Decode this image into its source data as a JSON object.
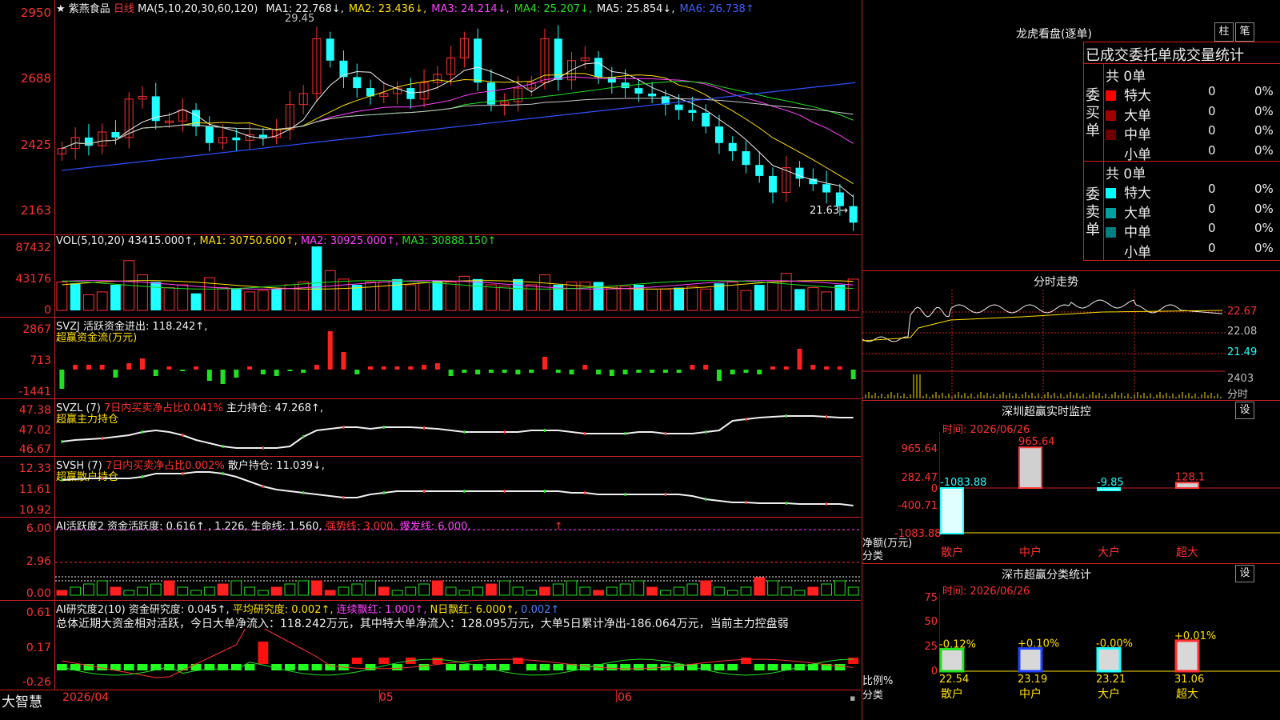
{
  "stock": {
    "name": "紫燕食品",
    "period": "日线"
  },
  "main": {
    "ma_label": "MA(5,10,20,30,60,120)",
    "ma": [
      {
        "label": "MA1: 22.768↓,",
        "color": "#f0f0f0"
      },
      {
        "label": "MA2: 23.436↓,",
        "color": "#ffe000"
      },
      {
        "label": "MA3: 24.214↓,",
        "color": "#ff40ff"
      },
      {
        "label": "MA4: 25.207↓,",
        "color": "#20e020"
      },
      {
        "label": "MA5: 25.854↓,",
        "color": "#f0f0f0"
      },
      {
        "label": "MA6: 26.738↑",
        "color": "#4060ff"
      }
    ],
    "y_ticks": [
      "2950",
      "2688",
      "2425",
      "2163"
    ],
    "high_label": "29.45",
    "low_label": "21.63→"
  },
  "vol": {
    "label": "VOL(5,10,20)",
    "value": "43415.000↑,",
    "ma1": "MA1: 30750.600↑,",
    "ma2": "MA2: 30925.000↑,",
    "ma3": "MA3: 30888.150↑",
    "y_ticks": [
      "87432",
      "43176",
      "0"
    ]
  },
  "svzj": {
    "label": "SVZJ",
    "text": "活跃资金进出: 118.242↑,",
    "sub": "超赢资金流(万元)",
    "y_ticks": [
      "2867",
      "713",
      "-1441"
    ]
  },
  "svzl": {
    "label": "SVZL (7)",
    "ratio": "7日内买卖净占比0.041%",
    "hold": "主力持仓: 47.268↑,",
    "sub": "超赢主力持仓",
    "y_ticks": [
      "47.38",
      "47.02",
      "46.67"
    ]
  },
  "svsh": {
    "label": "SVSH (7)",
    "ratio": "7日内买卖净占比0.002%",
    "hold": "散户持仓: 11.039↓,",
    "sub": "超赢散户持仓",
    "y_ticks": [
      "12.33",
      "11.61",
      "10.92"
    ]
  },
  "ai1": {
    "label": "AI活跃度2",
    "t1": "资金活跃度: 0.616↑",
    "t2": ", 1.226,",
    "t3": "生命线: 1.560,",
    "t4": "强势线: 3.000,",
    "t5": "爆发线: 6.000,",
    "t6": "↑",
    "y_ticks": [
      "6.00",
      "2.96",
      "0.00"
    ]
  },
  "ai2": {
    "label": "AI研究度2(10)",
    "t1": "资金研究度: 0.045↑,",
    "t2": "平均研究度: 0.002↑,",
    "t3": "连续飘红: 1.000↑,",
    "t4": "N日飘红: 6.000↑,",
    "t5": "0.002↑",
    "summary": "总体近期大资金相对活跃，今日大单净流入：118.242万元，其中特大单净流入：128.095万元，大单5日累计净出-186.064万元，当前主力控盘弱",
    "y_ticks": [
      "0.61",
      "0.17",
      "-0.26"
    ]
  },
  "xaxis": {
    "app": "大智慧",
    "labels": [
      "2026/04",
      "05",
      "06"
    ]
  },
  "right": {
    "dragon_title": "龙虎看盘(逐单)",
    "btn_col": "柱",
    "btn_pen": "笔",
    "stat_title": "已成交委托单成交量统计",
    "buy_group": "委买单",
    "sell_group": "委卖单",
    "buy_total": "共 0单",
    "sell_total": "共 0单",
    "buy_rows": [
      {
        "name": "特大",
        "val": "0",
        "pct": "0%",
        "color": "#ff0000"
      },
      {
        "name": "大单",
        "val": "0",
        "pct": "0%",
        "color": "#a00000"
      },
      {
        "name": "中单",
        "val": "0",
        "pct": "0%",
        "color": "#700000"
      },
      {
        "name": "小单",
        "val": "0",
        "pct": "0%",
        "color": ""
      }
    ],
    "sell_rows": [
      {
        "name": "特大",
        "val": "0",
        "pct": "0%",
        "color": "#00ffff"
      },
      {
        "name": "大单",
        "val": "0",
        "pct": "0%",
        "color": "#00a0a0"
      },
      {
        "name": "中单",
        "val": "0",
        "pct": "0%",
        "color": "#008080"
      },
      {
        "name": "小单",
        "val": "0",
        "pct": "0%",
        "color": ""
      }
    ],
    "intraday_title": "分时走势",
    "intraday_ticks": [
      "22.67",
      "22.08",
      "21.49"
    ],
    "intraday_vol": "2403",
    "intraday_vol_unit": "分时",
    "monitor_title": "深圳超赢实时监控",
    "monitor_set": "设",
    "monitor_time": "时间: 2026/06/26",
    "monitor_ticks": [
      "965.64",
      "282.47",
      "0",
      "-400.71",
      "-1083.88"
    ],
    "monitor_axis1": "净额(万元)",
    "monitor_axis2": "分类",
    "monitor_bars": [
      {
        "cat": "散户",
        "value": -1083.88,
        "label": "-1083.88"
      },
      {
        "cat": "中户",
        "value": 965.64,
        "label": "965.64"
      },
      {
        "cat": "大户",
        "value": -9.85,
        "label": "-9.85"
      },
      {
        "cat": "超大",
        "value": 128.1,
        "label": "128.1"
      }
    ],
    "class_title": "深市超赢分类统计",
    "class_set": "设",
    "class_time": "时间: 2026/06/26",
    "class_ticks": [
      "75",
      "50",
      "25",
      "0"
    ],
    "class_axis1": "比例%",
    "class_axis2": "分类",
    "class_bars": [
      {
        "cat": "散户",
        "value": 22.54,
        "label": "22.54",
        "chg": "-0.12%"
      },
      {
        "cat": "中户",
        "value": 23.19,
        "label": "23.19",
        "chg": "+0.10%"
      },
      {
        "cat": "大户",
        "value": 23.21,
        "label": "23.21",
        "chg": "-0.00%"
      },
      {
        "cat": "超大",
        "value": 31.06,
        "label": "31.06",
        "chg": "+0.01%"
      }
    ]
  },
  "chart_data": [
    {
      "type": "candlestick",
      "title": "紫燕食品 日线",
      "ylim": [
        21.63,
        29.45
      ],
      "y_ticks": [
        29.5,
        26.88,
        24.25,
        21.63
      ],
      "x_labels": [
        "2026/04",
        "05",
        "06"
      ]
    },
    {
      "type": "bar",
      "title": "超赢实时监控",
      "categories": [
        "散户",
        "中户",
        "大户",
        "超大"
      ],
      "values": [
        -1083.88,
        965.64,
        -9.85,
        128.1
      ],
      "ylabel": "净额(万元)"
    },
    {
      "type": "bar",
      "title": "超赢分类统计",
      "categories": [
        "散户",
        "中户",
        "大户",
        "超大"
      ],
      "values": [
        22.54,
        23.19,
        23.21,
        31.06
      ],
      "ylabel": "比例%",
      "ylim": [
        0,
        75
      ]
    }
  ]
}
